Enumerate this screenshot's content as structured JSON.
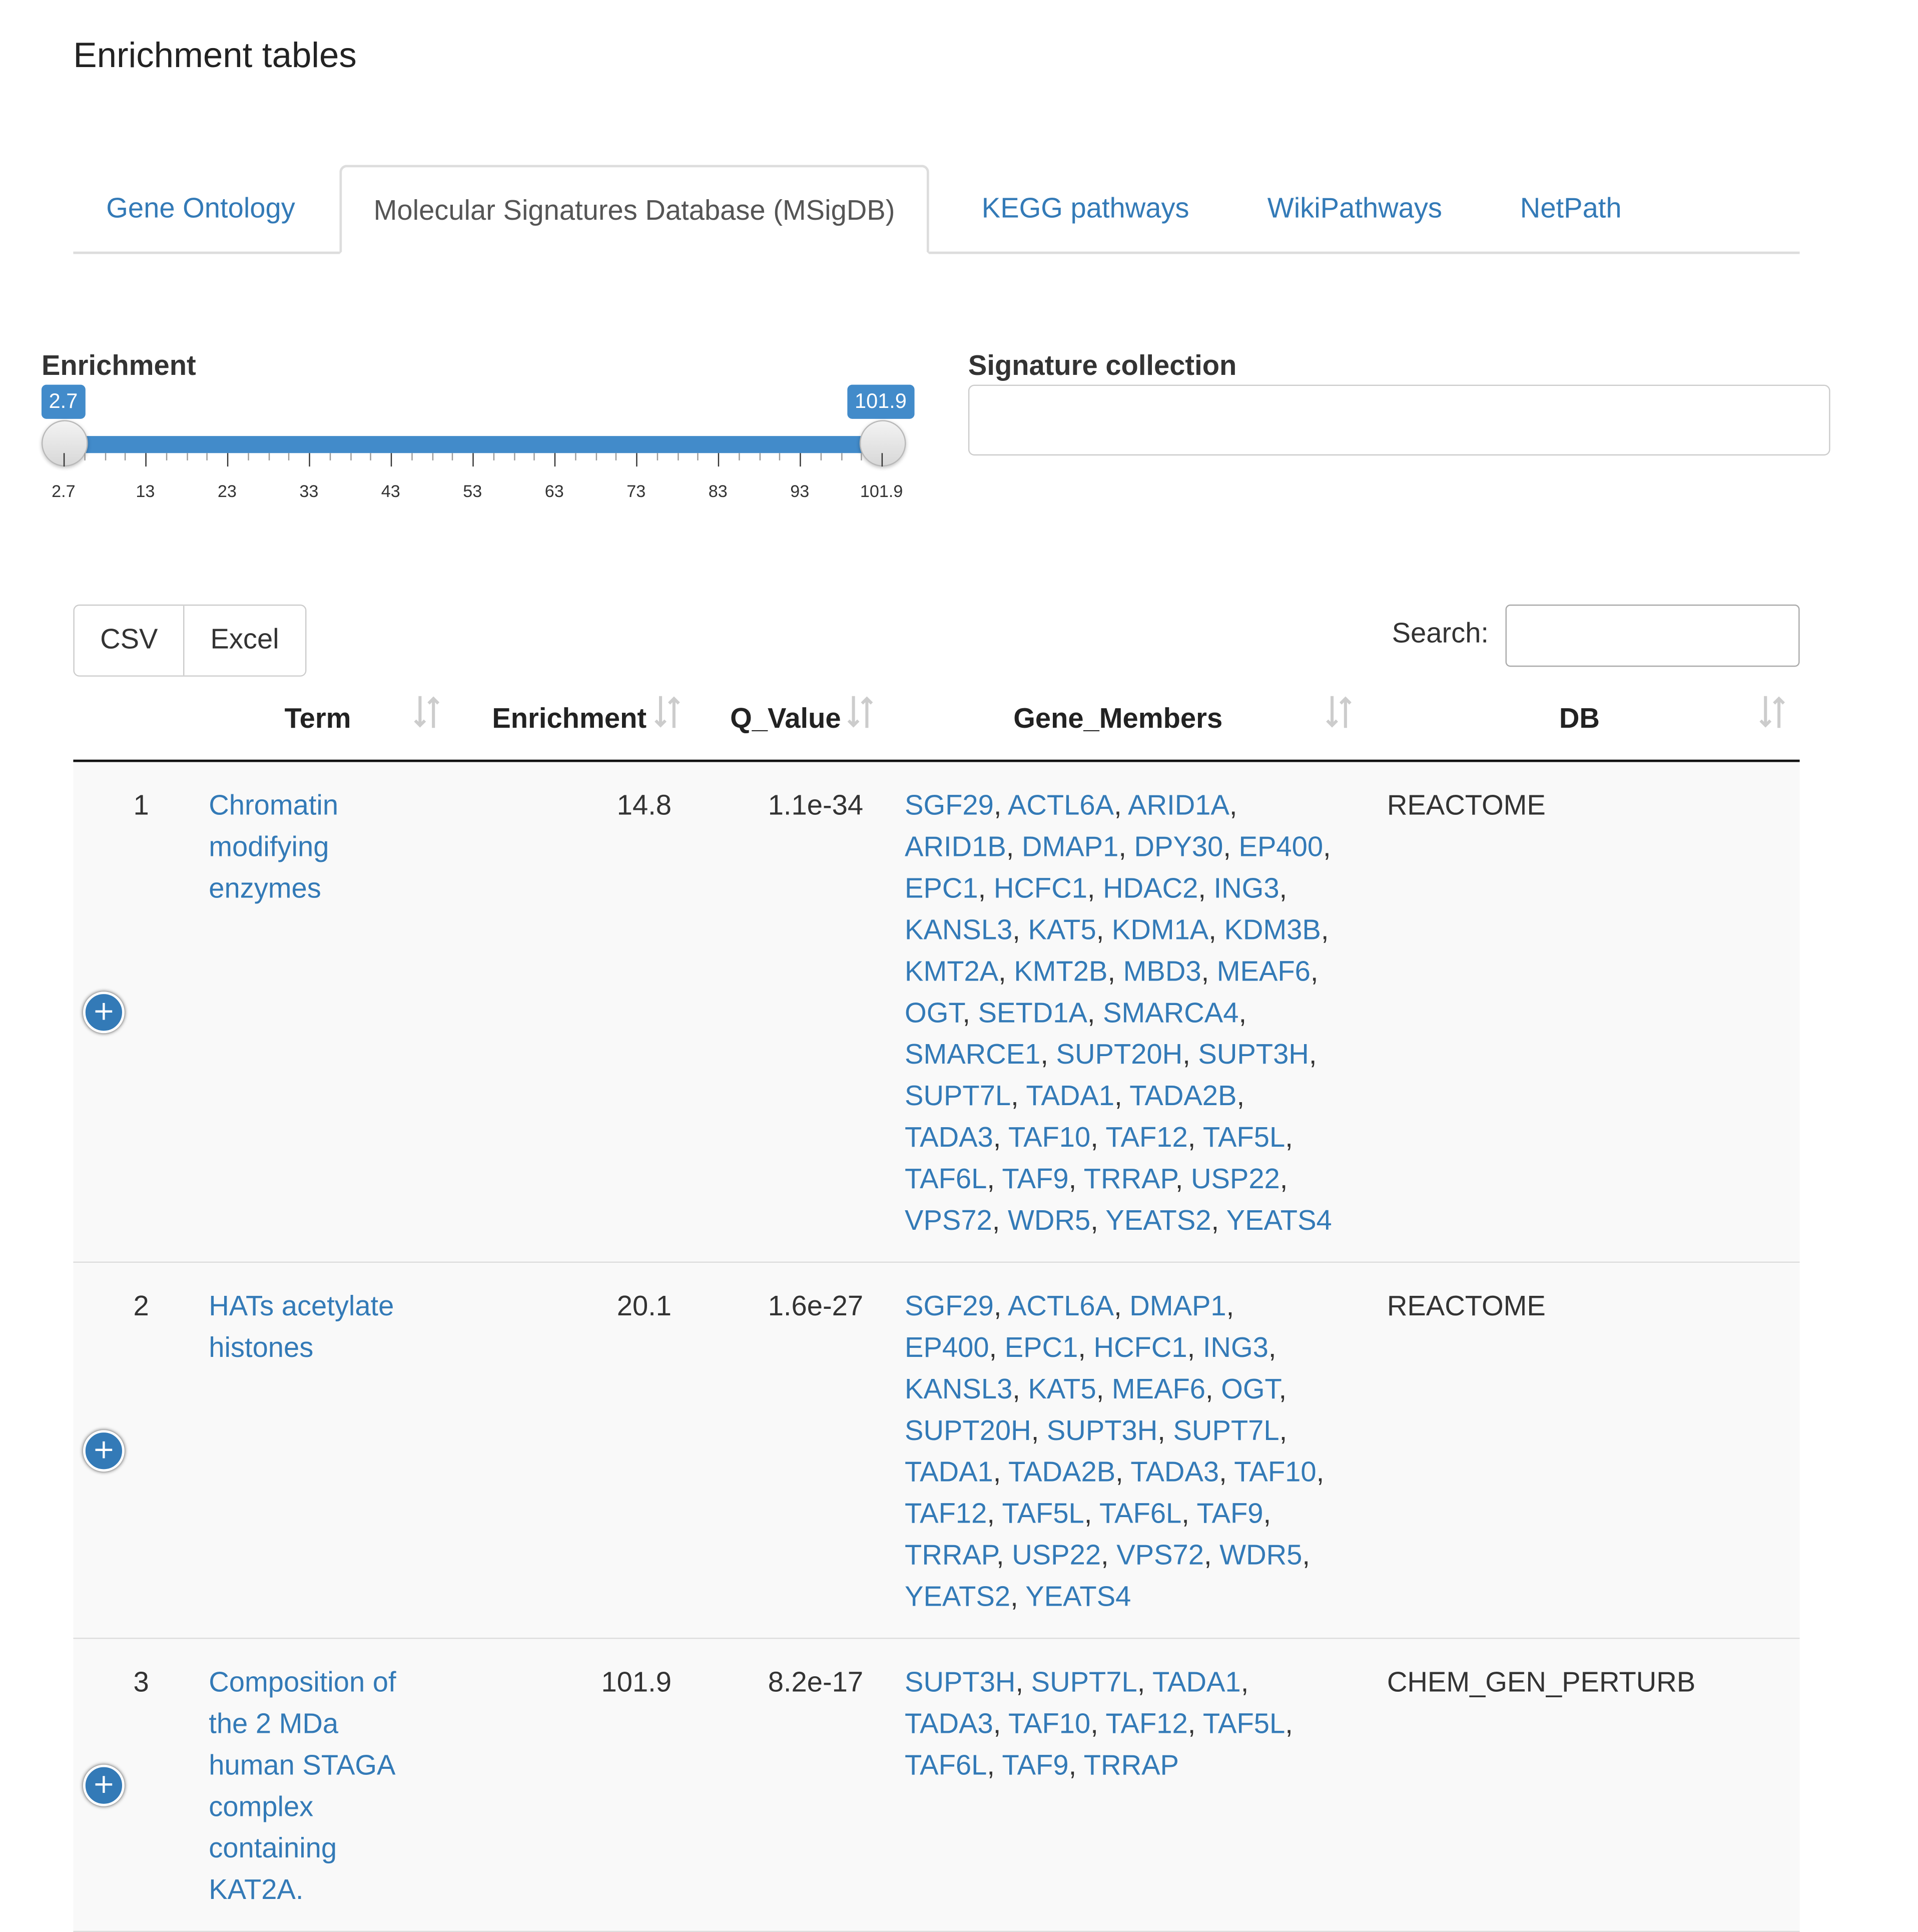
{
  "page": {
    "title": "Enrichment tables"
  },
  "tabs": [
    {
      "label": "Gene Ontology",
      "active": false
    },
    {
      "label": "Molecular Signatures Database (MSigDB)",
      "active": true
    },
    {
      "label": "KEGG pathways",
      "active": false
    },
    {
      "label": "WikiPathways",
      "active": false
    },
    {
      "label": "NetPath",
      "active": false
    }
  ],
  "filters": {
    "enrichment": {
      "label": "Enrichment",
      "min_value": "2.7",
      "max_value": "101.9",
      "ticks": [
        "2.7",
        "13",
        "23",
        "33",
        "43",
        "53",
        "63",
        "73",
        "83",
        "93",
        "101.9"
      ]
    },
    "signature_collection": {
      "label": "Signature collection",
      "value": ""
    }
  },
  "buttons": {
    "csv": "CSV",
    "excel": "Excel"
  },
  "search": {
    "label": "Search:",
    "value": ""
  },
  "table": {
    "columns": [
      "Term",
      "Enrichment",
      "Q_Value",
      "Gene_Members",
      "DB"
    ],
    "rows": [
      {
        "index": "1",
        "term_lines": [
          "Chromatin",
          "modifying",
          "enzymes"
        ],
        "enrichment": "14.8",
        "q_value": "1.1e-34",
        "gene_lines": [
          [
            "SGF29",
            "ACTL6A",
            "ARID1A"
          ],
          [
            "ARID1B",
            "DMAP1",
            "DPY30",
            "EP400"
          ],
          [
            "EPC1",
            "HCFC1",
            "HDAC2",
            "ING3"
          ],
          [
            "KANSL3",
            "KAT5",
            "KDM1A",
            "KDM3B"
          ],
          [
            "KMT2A",
            "KMT2B",
            "MBD3",
            "MEAF6"
          ],
          [
            "OGT",
            "SETD1A",
            "SMARCA4"
          ],
          [
            "SMARCE1",
            "SUPT20H",
            "SUPT3H"
          ],
          [
            "SUPT7L",
            "TADA1",
            "TADA2B"
          ],
          [
            "TADA3",
            "TAF10",
            "TAF12",
            "TAF5L"
          ],
          [
            "TAF6L",
            "TAF9",
            "TRRAP",
            "USP22"
          ],
          [
            "VPS72",
            "WDR5",
            "YEATS2",
            "YEATS4"
          ]
        ],
        "db": "REACTOME"
      },
      {
        "index": "2",
        "term_lines": [
          "HATs acetylate",
          "histones"
        ],
        "enrichment": "20.1",
        "q_value": "1.6e-27",
        "gene_lines": [
          [
            "SGF29",
            "ACTL6A",
            "DMAP1"
          ],
          [
            "EP400",
            "EPC1",
            "HCFC1",
            "ING3"
          ],
          [
            "KANSL3",
            "KAT5",
            "MEAF6",
            "OGT"
          ],
          [
            "SUPT20H",
            "SUPT3H",
            "SUPT7L"
          ],
          [
            "TADA1",
            "TADA2B",
            "TADA3",
            "TAF10"
          ],
          [
            "TAF12",
            "TAF5L",
            "TAF6L",
            "TAF9"
          ],
          [
            "TRRAP",
            "USP22",
            "VPS72",
            "WDR5"
          ],
          [
            "YEATS2",
            "YEATS4"
          ]
        ],
        "db": "REACTOME"
      },
      {
        "index": "3",
        "term_lines": [
          "Composition of",
          "the 2 MDa",
          "human STAGA",
          "complex",
          "containing",
          "KAT2A."
        ],
        "enrichment": "101.9",
        "q_value": "8.2e-17",
        "gene_lines": [
          [
            "SUPT3H",
            "SUPT7L",
            "TADA1"
          ],
          [
            "TADA3",
            "TAF10",
            "TAF12",
            "TAF5L"
          ],
          [
            "TAF6L",
            "TAF9",
            "TRRAP"
          ]
        ],
        "db": "CHEM_GEN_PERTURB"
      }
    ]
  },
  "colors": {
    "link": "#337ab7",
    "slider": "#428bca"
  },
  "icons": {
    "sort": "sort-icon",
    "expand": "plus-circle-icon"
  }
}
